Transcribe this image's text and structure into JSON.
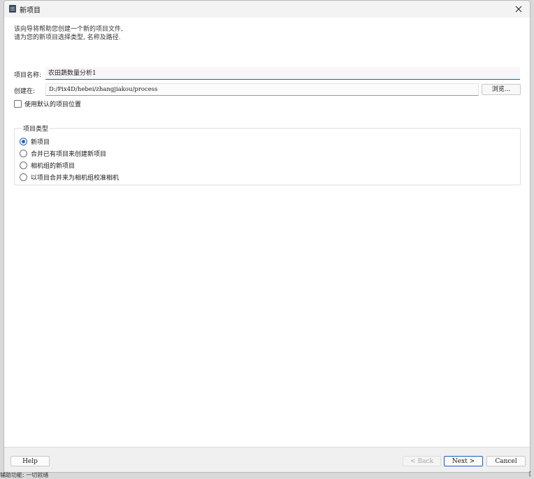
{
  "window": {
    "title": "新项目",
    "close_glyph": "✕"
  },
  "intro": {
    "line1": "该向导将帮助您创建一个新的项目文件,",
    "line2": "请为您的新项目选择类型, 名称及路径."
  },
  "form": {
    "name_label": "项目名称:",
    "name_value": "农田蔬数量分析1",
    "path_label": "创建在:",
    "path_value": "D:/Pix4D/hebei/zhangjiakou/process",
    "browse_label": "浏览...",
    "default_location_label": "使用默认的项目位置",
    "default_location_checked": false
  },
  "project_type": {
    "title": "项目类型",
    "options": [
      {
        "label": "新项目",
        "selected": true
      },
      {
        "label": "合并已有项目来创建新项目",
        "selected": false
      },
      {
        "label": "相机组的新项目",
        "selected": false
      },
      {
        "label": "以项目合并来为相机组校准相机",
        "selected": false
      }
    ]
  },
  "footer": {
    "help": "Help",
    "back": "< Back",
    "next": "Next >",
    "cancel": "Cancel"
  },
  "taskbar": {
    "left_text": "辅助功能: 一切就绪",
    "right_text": "["
  }
}
